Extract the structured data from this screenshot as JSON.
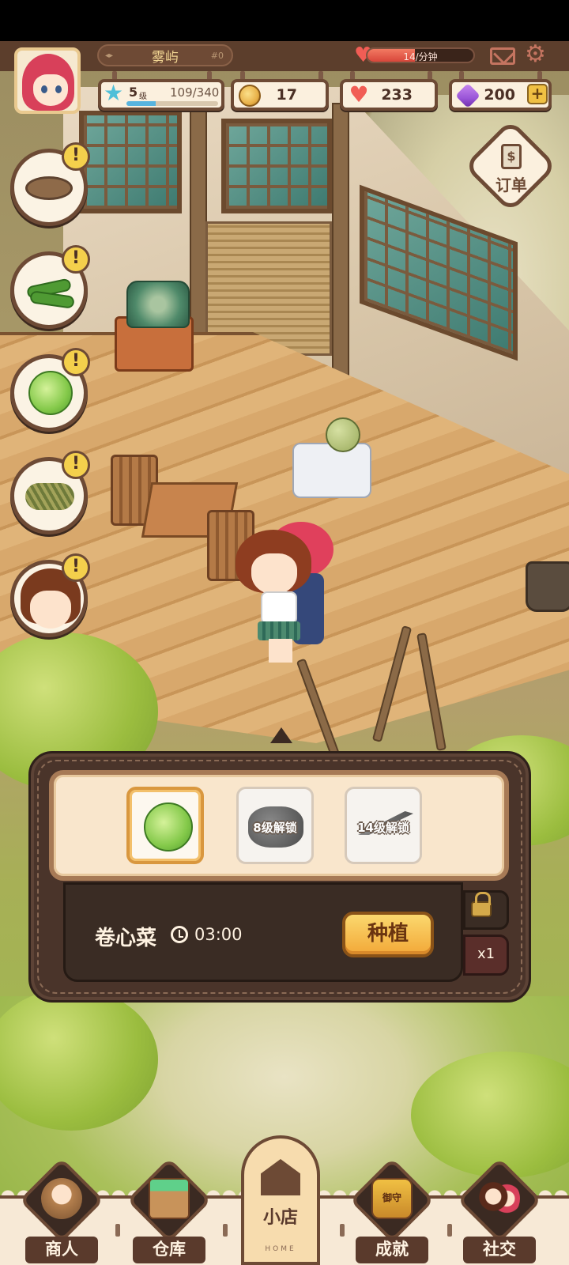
{
  "player": {
    "name": "雾屿",
    "id_tag": "#0",
    "level": "5",
    "level_unit": "级",
    "xp": "109/340",
    "xp_fraction": 0.32
  },
  "rate": {
    "text": "14/分钟",
    "fill_fraction": 0.45
  },
  "resources": {
    "coins": "17",
    "hearts": "233",
    "gems": "200",
    "add_label": "+"
  },
  "order_button": {
    "label": "订单",
    "icon_symbol": "$"
  },
  "quests": [
    {
      "icon": "soil-plot-icon",
      "alert": "!"
    },
    {
      "icon": "cucumber-icon",
      "alert": "!"
    },
    {
      "icon": "cabbage-icon",
      "alert": "!"
    },
    {
      "icon": "herb-icon",
      "alert": "!"
    },
    {
      "icon": "npc-girl-avatar",
      "alert": "!"
    }
  ],
  "plant_panel": {
    "slots": [
      {
        "icon": "cabbage-icon",
        "label": "",
        "selected": true
      },
      {
        "icon": "locked-mushroom-icon",
        "label": "8级解锁",
        "selected": false
      },
      {
        "icon": "locked-carrot-icon",
        "label": "14级解锁",
        "selected": false
      }
    ],
    "crop_name": "卷心菜",
    "crop_time": "03:00",
    "plant_button": "种植",
    "multiplier": "x1"
  },
  "nav": {
    "merchant": "商人",
    "warehouse": "仓库",
    "home": "小店",
    "home_sub": "HOME",
    "achievements": "成就",
    "social": "社交",
    "achievement_badge_text": "御守"
  },
  "colors": {
    "panel_brown": "#4a342a",
    "accent_orange": "#f2a838",
    "heart_red": "#f15d55",
    "gem_purple": "#9a55d8",
    "coin_gold": "#e9b24a"
  }
}
